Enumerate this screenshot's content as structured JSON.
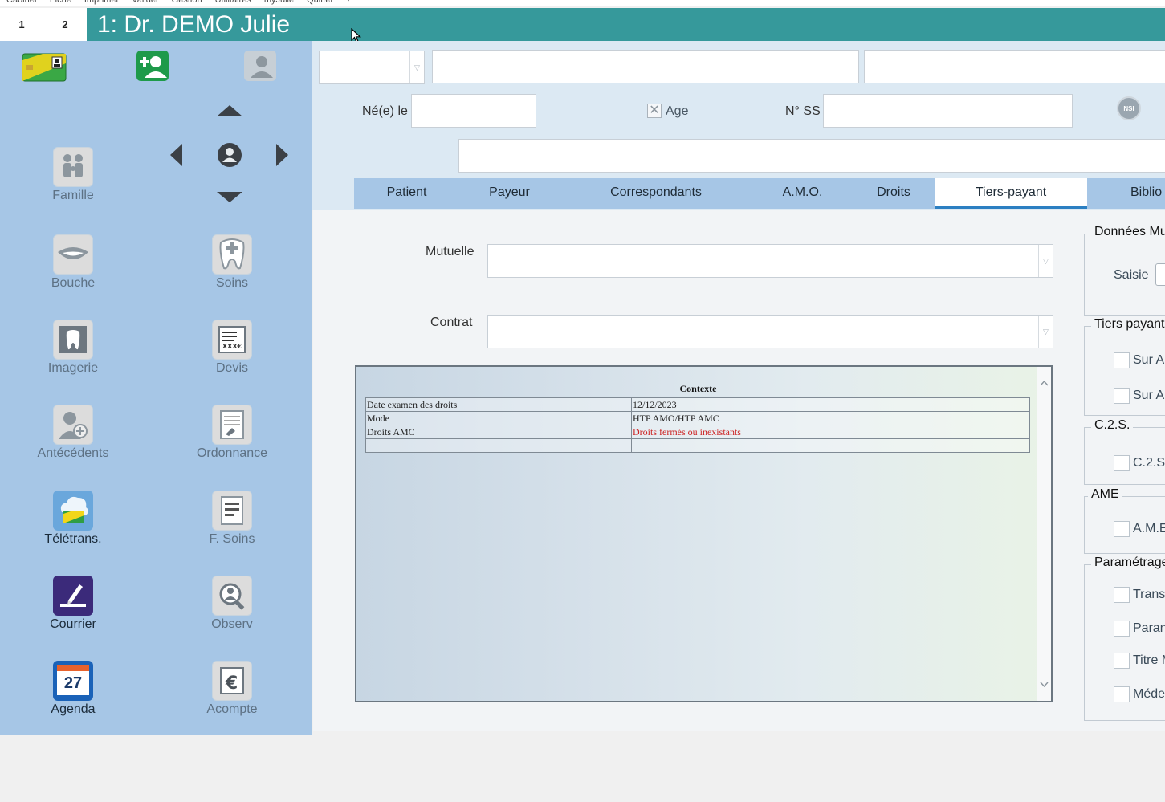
{
  "menu": [
    "Cabinet",
    "Fiche",
    "Imprimer",
    "Valider",
    "Gestion",
    "Utilitaires",
    "myJulie",
    "Quitter",
    "?"
  ],
  "header": {
    "tab1": "1",
    "tab2": "2",
    "title": "1: Dr. DEMO Julie"
  },
  "sidebar": {
    "tiles": [
      {
        "label": "Famille"
      },
      {
        "label": "Bouche"
      },
      {
        "label": "Soins"
      },
      {
        "label": "Imagerie"
      },
      {
        "label": "Devis"
      },
      {
        "label": "Antécédents"
      },
      {
        "label": "Ordonnance"
      },
      {
        "label": "Télétrans."
      },
      {
        "label": "F. Soins"
      },
      {
        "label": "Courrier"
      },
      {
        "label": "Observ"
      },
      {
        "label": "Agenda"
      },
      {
        "label": "Acompte"
      }
    ],
    "agenda_day": "27"
  },
  "identity": {
    "birth_label": "Né(e) le",
    "age_label": "Age",
    "ss_label": "N° SS",
    "birth_value": "",
    "ss_value": "",
    "nsi_badge": "NSI"
  },
  "tabs": [
    "Patient",
    "Payeur",
    "Correspondants",
    "A.M.O.",
    "Droits",
    "Tiers-payant",
    "Biblio"
  ],
  "tiers_payant": {
    "mutuelle_label": "Mutuelle",
    "contrat_label": "Contrat",
    "context": {
      "title": "Contexte",
      "rows": [
        {
          "label": "Date examen des droits",
          "value": "12/12/2023"
        },
        {
          "label": "Mode",
          "value": "HTP AMO/HTP AMC"
        },
        {
          "label": "Droits AMC",
          "value": "Droits fermés ou inexistants"
        }
      ]
    },
    "groups": {
      "donnees": "Données Mu",
      "saisie": "Saisie",
      "tiers": "Tiers payant",
      "sur1": "Sur A",
      "sur2": "Sur A",
      "c2s": "C.2.S.",
      "c2s_opt": "C.2.S",
      "ame": "AME",
      "ame_opt": "A.M.E",
      "param": "Paramétrage",
      "trans": "Trans",
      "param_opt": "Paran",
      "titre": "Titre M",
      "med": "Méde"
    }
  },
  "colors": {
    "title_bar": "#36999b",
    "sidebar": "#a6c6e6",
    "active_tab": "#2b7fc2",
    "warning_text": "#cc2222"
  }
}
